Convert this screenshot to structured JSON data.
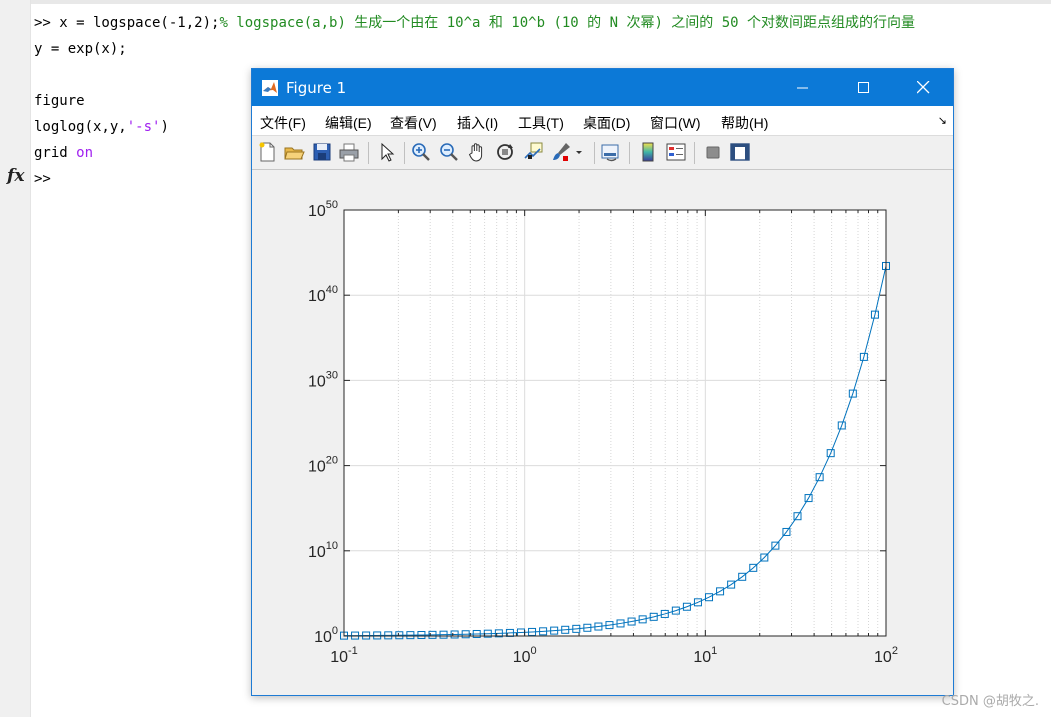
{
  "command_window": {
    "lines": [
      {
        "code": ">> x = logspace(-1,2);",
        "comment": "% logspace(a,b) 生成一个由在 10^a 和 10^b (10 的 N 次幂) 之间的 50 个对数间距点组成的行向量"
      },
      {
        "code": "y = exp(x);"
      },
      {
        "code": ""
      },
      {
        "code": "figure"
      },
      {
        "code": "loglog(x,y,",
        "string": "'-s'",
        "tail": ")"
      },
      {
        "code": "grid ",
        "keyword": "on"
      },
      {
        "code": ">>"
      }
    ],
    "fx_label": "fx"
  },
  "figure_window": {
    "title": "Figure 1",
    "menu": [
      {
        "label": "文件(F)"
      },
      {
        "label": "编辑(E)"
      },
      {
        "label": "查看(V)"
      },
      {
        "label": "插入(I)"
      },
      {
        "label": "工具(T)"
      },
      {
        "label": "桌面(D)"
      },
      {
        "label": "窗口(W)"
      },
      {
        "label": "帮助(H)"
      }
    ],
    "toolbar_icons": [
      "new-figure-icon",
      "open-file-icon",
      "save-icon",
      "print-icon",
      "select-pointer-icon",
      "zoom-in-icon",
      "zoom-out-icon",
      "pan-hand-icon",
      "rotate-3d-icon",
      "data-cursor-icon",
      "brush-icon",
      "link-plot-icon",
      "colorbar-icon",
      "legend-icon",
      "hide-plot-tools-icon",
      "show-plot-tools-icon"
    ]
  },
  "chart_data": {
    "type": "line",
    "title": "",
    "xlabel": "",
    "ylabel": "",
    "x_scale": "log",
    "y_scale": "log",
    "xlim": [
      0.1,
      100
    ],
    "ylim": [
      1,
      1e+50
    ],
    "grid": true,
    "marker": "square",
    "line_color": "#0072bd",
    "x_ticks": [
      {
        "base": "10",
        "exp": "-1",
        "value": 0.1
      },
      {
        "base": "10",
        "exp": "0",
        "value": 1
      },
      {
        "base": "10",
        "exp": "1",
        "value": 10
      },
      {
        "base": "10",
        "exp": "2",
        "value": 100
      }
    ],
    "y_ticks": [
      {
        "base": "10",
        "exp": "0",
        "value": 1
      },
      {
        "base": "10",
        "exp": "10",
        "value": 10000000000.0
      },
      {
        "base": "10",
        "exp": "20",
        "value": 1e+20
      },
      {
        "base": "10",
        "exp": "30",
        "value": 1e+30
      },
      {
        "base": "10",
        "exp": "40",
        "value": 1e+40
      },
      {
        "base": "10",
        "exp": "50",
        "value": 1e+50
      }
    ],
    "series": [
      {
        "x_log_start": -1,
        "x_log_end": 2,
        "points": 50,
        "function": "y = exp(x)"
      }
    ]
  },
  "watermark": "CSDN @胡牧之."
}
